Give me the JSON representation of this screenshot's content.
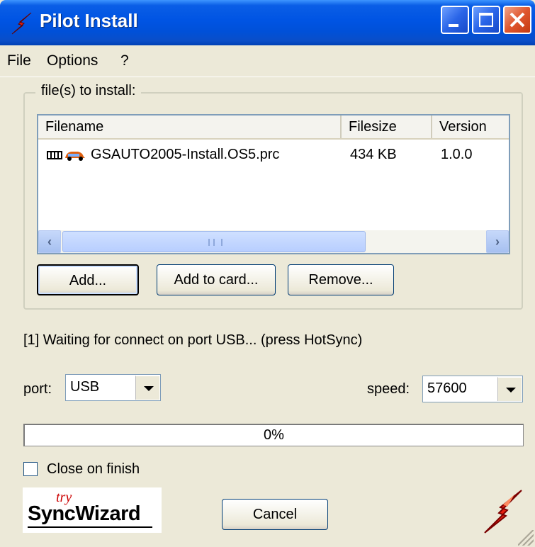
{
  "window": {
    "title": "Pilot Install",
    "controls": {
      "minimize": "minimize-icon",
      "maximize": "maximize-icon",
      "close": "close-icon"
    }
  },
  "menu": {
    "items": [
      "File",
      "Options",
      "?"
    ]
  },
  "files_group": {
    "label": "file(s) to install:",
    "columns": [
      "Filename",
      "Filesize",
      "Version"
    ],
    "rows": [
      {
        "filename": "GSAUTO2005-Install.OS5.prc",
        "filesize": "434 KB",
        "version": "1.0.0",
        "icon": "palm-app-icon"
      }
    ],
    "buttons": {
      "add": "Add...",
      "add_to_card": "Add to card...",
      "remove": "Remove..."
    }
  },
  "status": "[1] Waiting for connect on port USB... (press HotSync)",
  "port": {
    "label": "port:",
    "value": "USB"
  },
  "speed": {
    "label": "speed:",
    "value": "57600"
  },
  "progress": {
    "percent": 0,
    "text": "0%"
  },
  "close_on_finish": {
    "label": "Close on finish",
    "checked": false
  },
  "logo": {
    "small": "try",
    "main": "SyncWizard"
  },
  "cancel_label": "Cancel",
  "colors": {
    "title_blue": "#0054e3",
    "face": "#ece9d8",
    "accent_red": "#cc0000"
  }
}
